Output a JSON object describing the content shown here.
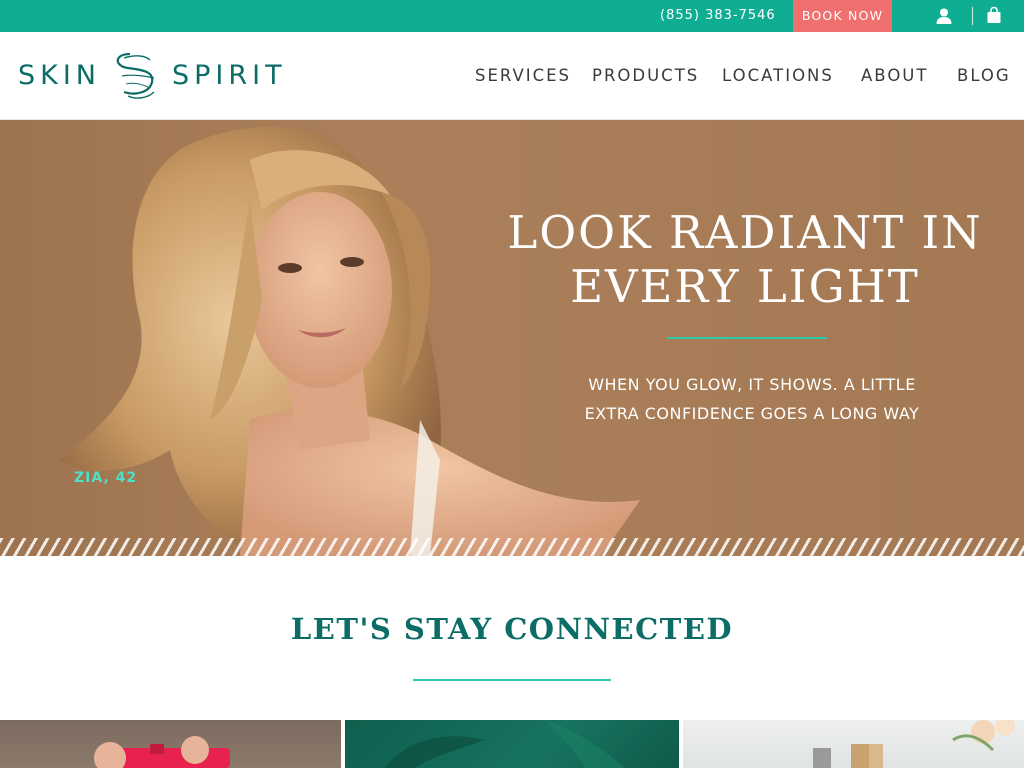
{
  "topbar": {
    "phone": "(855) 383-7546",
    "book_label": "BOOK NOW",
    "background": "#0fae93",
    "book_color": "#f07070",
    "icons": [
      "user-icon",
      "shopping-bag-icon"
    ]
  },
  "header": {
    "logo_left": "SKIN",
    "logo_right": "SPIRIT",
    "nav": [
      "SERVICES",
      "PRODUCTS",
      "LOCATIONS",
      "ABOUT",
      "BLOG"
    ],
    "brand_color": "#0b6d66"
  },
  "hero": {
    "title_line1": "LOOK RADIANT IN",
    "title_line2": "EVERY LIGHT",
    "sub_line1": "WHEN YOU GLOW, IT SHOWS. A LITTLE",
    "sub_line2": "EXTRA CONFIDENCE GOES A LONG WAY",
    "caption": "ZIA, 42",
    "accent": "#2ec7b0"
  },
  "section": {
    "title": "LET'S STAY CONNECTED"
  }
}
